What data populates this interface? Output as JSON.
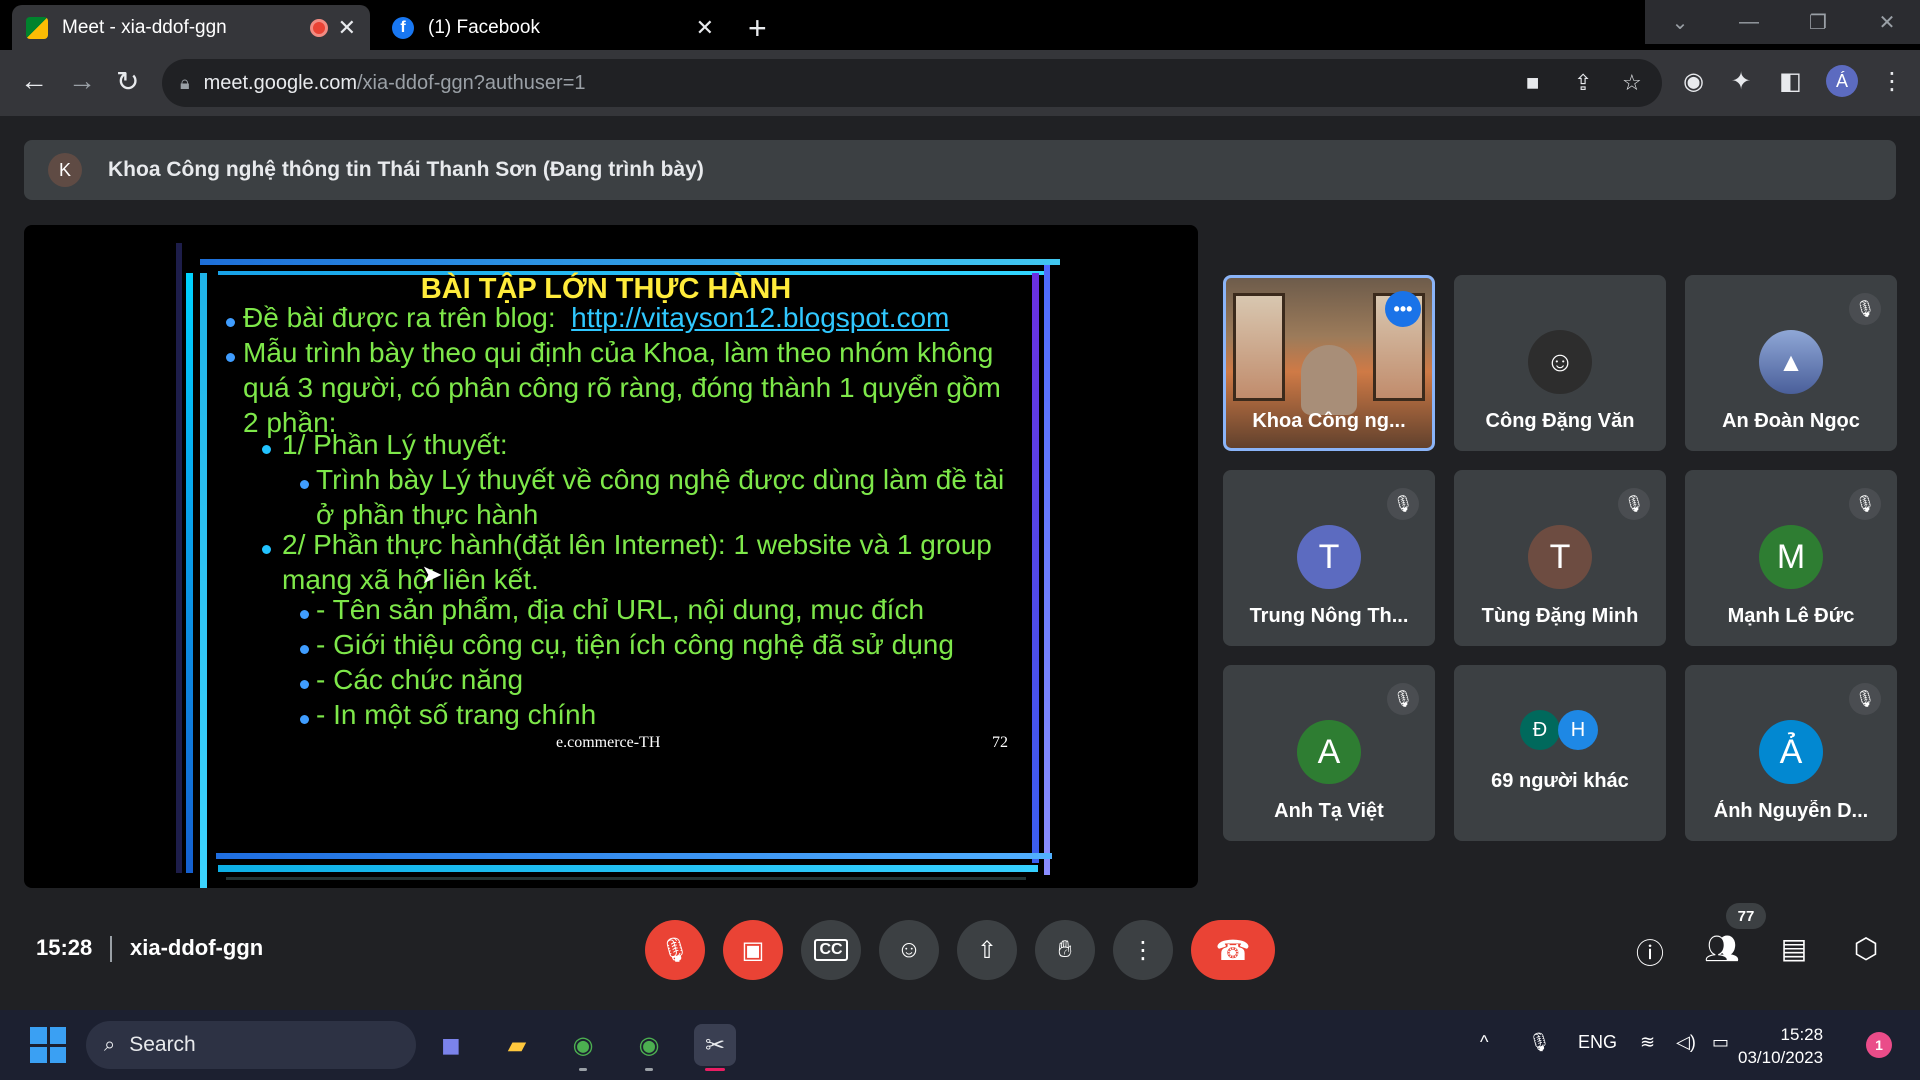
{
  "browser": {
    "tabs": [
      {
        "title": "Meet - xia-ddof-ggn",
        "active": true
      },
      {
        "title": "(1) Facebook",
        "active": false
      }
    ],
    "url_host": "meet.google.com",
    "url_path": "/xia-ddof-ggn?authuser=1",
    "profile_initial": "Á"
  },
  "presenter": {
    "initial": "K",
    "text": "Khoa Công nghệ thông tin Thái Thanh Sơn (Đang trình bày)"
  },
  "slide": {
    "title": "BÀI TẬP LỚN THỰC HÀNH",
    "line1_prefix": "Đề bài được ra trên blog:",
    "line1_link": "http://vitayson12.blogspot.com",
    "line2a": "Mẫu trình bày theo qui định của Khoa, làm theo nhóm không",
    "line2b": "quá 3 người, có phân công rõ ràng, đóng thành 1 quyển gồm",
    "line2c": "2 phần:",
    "line3": "1/ Phần Lý thuyết:",
    "line4a": "Trình bày Lý thuyết về công nghệ được dùng làm đề tài",
    "line4b": "ở phần thực hành",
    "line5a": "2/ Phần thực hành(đặt lên Internet): 1 website và 1 group",
    "line5b": "mạng xã hội liên kết.",
    "line6": "- Tên sản phẩm, địa chỉ URL, nội dung, mục đích",
    "line7": "- Giới thiệu công cụ, tiện ích công nghệ đã sử dụng",
    "line8": "- Các chức năng",
    "line9": "- In một số trang chính",
    "footer": "e.commerce-TH",
    "page_number": "72"
  },
  "participants": [
    {
      "name": "Khoa Công ng...",
      "initial": "",
      "color": "",
      "muted": false
    },
    {
      "name": "Công Đặng Văn",
      "initial": "",
      "color": "#2d2d2d",
      "muted": false
    },
    {
      "name": "An Đoàn Ngọc",
      "initial": "",
      "color": "#6a7fb5",
      "muted": true
    },
    {
      "name": "Trung Nông Th...",
      "initial": "T",
      "color": "#5c6bc0",
      "muted": true
    },
    {
      "name": "Tùng Đặng Minh",
      "initial": "T",
      "color": "#6d4c41",
      "muted": true
    },
    {
      "name": "Mạnh Lê Đức",
      "initial": "M",
      "color": "#2e7d32",
      "muted": true
    },
    {
      "name": "Anh Tạ Việt",
      "initial": "A",
      "color": "#2e7d32",
      "muted": true
    },
    {
      "name": "69 người khác",
      "initial_a": "Đ",
      "initial_b": "H",
      "color_a": "#00695c",
      "color_b": "#1e88e5",
      "muted": false
    },
    {
      "name": "Ảnh Nguyễn D...",
      "initial": "Ả",
      "color": "#0288d1",
      "muted": true
    }
  ],
  "meeting": {
    "time": "15:28",
    "code": "xia-ddof-ggn",
    "people_count": "77"
  },
  "taskbar": {
    "search_label": "Search",
    "language": "ENG",
    "time": "15:28",
    "date": "03/10/2023",
    "notifications": "1"
  }
}
